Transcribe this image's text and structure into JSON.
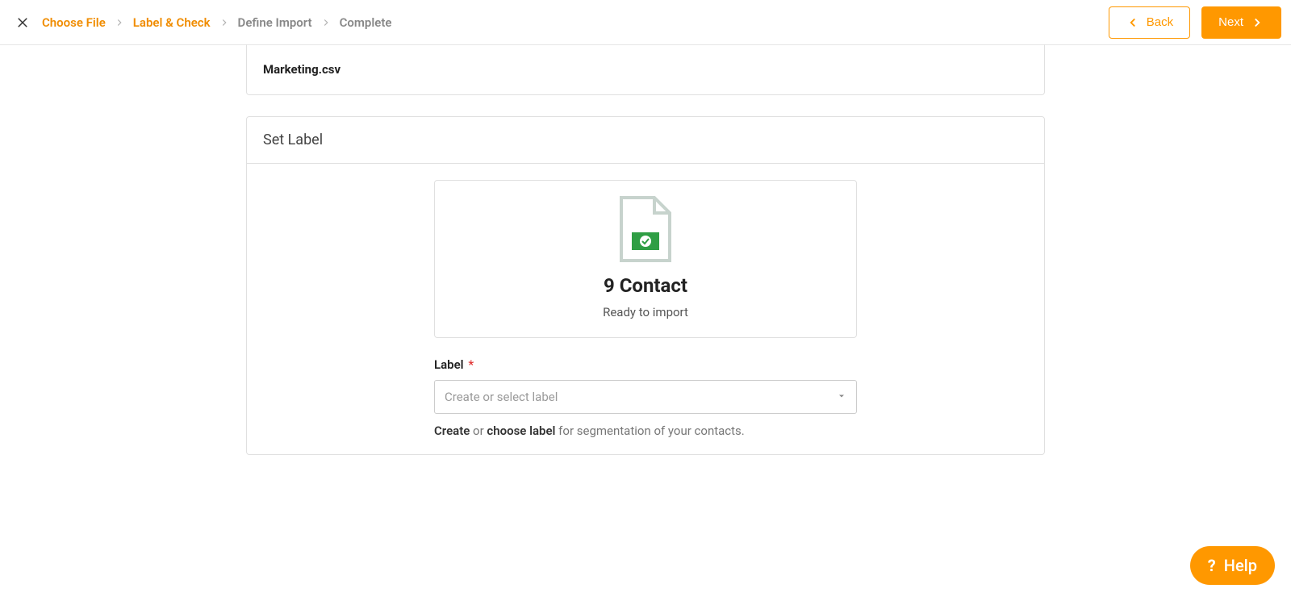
{
  "breadcrumbs": {
    "items": [
      {
        "label": "Choose File",
        "active": true
      },
      {
        "label": "Label & Check",
        "active": true
      },
      {
        "label": "Define Import",
        "active": false
      },
      {
        "label": "Complete",
        "active": false
      }
    ]
  },
  "nav": {
    "back": "Back",
    "next": "Next"
  },
  "file": {
    "name": "Marketing.csv"
  },
  "panel": {
    "title": "Set Label",
    "count_label": "9 Contact",
    "ready": "Ready to import",
    "field_label": "Label",
    "required_mark": "*",
    "select_placeholder": "Create or select label",
    "helper_strong1": "Create",
    "helper_mid": " or ",
    "helper_strong2": "choose label",
    "helper_rest": " for segmentation of your contacts."
  },
  "help": {
    "q": "?",
    "label": "Help"
  }
}
